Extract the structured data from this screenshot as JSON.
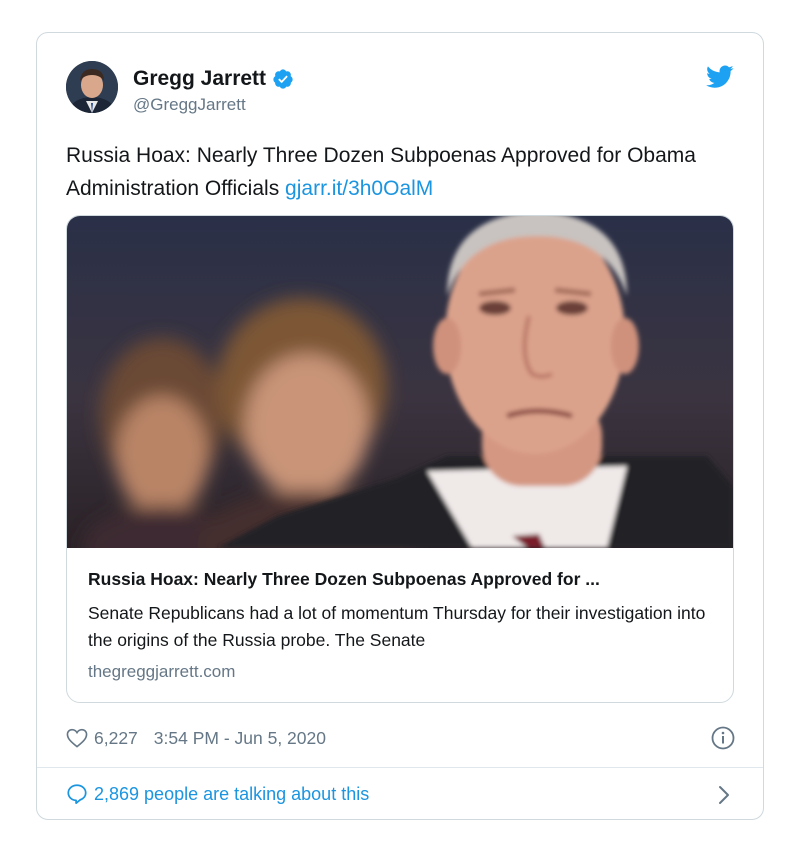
{
  "tweet": {
    "author_name": "Gregg Jarrett",
    "author_handle": "@GreggJarrett",
    "text": "Russia Hoax: Nearly Three Dozen Subpoenas Approved for Obama Administration Officials",
    "link_text": "gjarr.it/3h0OalM"
  },
  "link_card": {
    "title": "Russia Hoax: Nearly Three Dozen Subpoenas Approved for ...",
    "description": "Senate Republicans had a lot of momentum Thursday for their investigation into the origins of the Russia probe. The Senate",
    "domain": "thegreggjarrett.com"
  },
  "footer": {
    "likes": "6,227",
    "timestamp": "3:54 PM - Jun 5, 2020",
    "talking": "2,869 people are talking about this"
  },
  "colors": {
    "accent": "#1b95e0",
    "verified": "#1da1f2",
    "muted": "#657786",
    "border": "#cfd9de"
  },
  "icons": [
    "verified-badge-icon",
    "twitter-bird-icon",
    "heart-icon",
    "info-icon",
    "reply-bubble-icon",
    "chevron-right-icon"
  ]
}
